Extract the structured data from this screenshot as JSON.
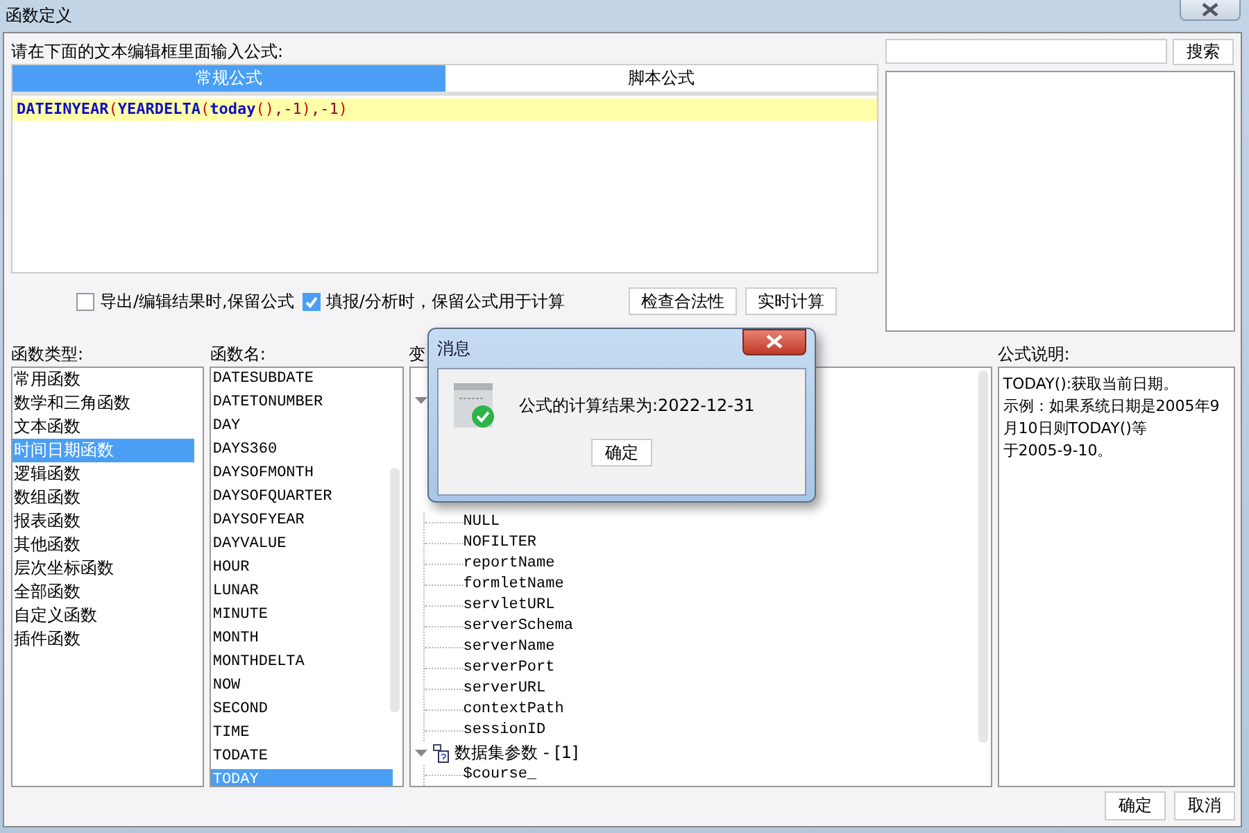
{
  "window": {
    "title": "函数定义"
  },
  "prompt": "请在下面的文本编辑框里面输入公式:",
  "tabs": [
    {
      "label": "常规公式",
      "selected": true
    },
    {
      "label": "脚本公式",
      "selected": false
    }
  ],
  "formula": [
    {
      "text": "DATEINYEAR",
      "kind": "function"
    },
    {
      "text": "(",
      "kind": "paren"
    },
    {
      "text": "YEARDELTA",
      "kind": "function"
    },
    {
      "text": "(",
      "kind": "paren"
    },
    {
      "text": "today",
      "kind": "function"
    },
    {
      "text": "()",
      "kind": "paren"
    },
    {
      "text": ",-1",
      "kind": "number"
    },
    {
      "text": ")",
      "kind": "paren"
    },
    {
      "text": ",-1",
      "kind": "number"
    },
    {
      "text": ")",
      "kind": "paren"
    }
  ],
  "search": {
    "button": "搜索"
  },
  "options": [
    {
      "label": "导出/编辑结果时,保留公式",
      "checked": false
    },
    {
      "label": "填报/分析时，保留公式用于计算",
      "checked": true
    }
  ],
  "actions": [
    "检查合法性",
    "实时计算"
  ],
  "categories": {
    "title": "函数类型:",
    "items": [
      {
        "label": "常用函数",
        "selected": false
      },
      {
        "label": "数学和三角函数",
        "selected": false
      },
      {
        "label": "文本函数",
        "selected": false
      },
      {
        "label": "时间日期函数",
        "selected": true
      },
      {
        "label": "逻辑函数",
        "selected": false
      },
      {
        "label": "数组函数",
        "selected": false
      },
      {
        "label": "报表函数",
        "selected": false
      },
      {
        "label": "其他函数",
        "selected": false
      },
      {
        "label": "层次坐标函数",
        "selected": false
      },
      {
        "label": "全部函数",
        "selected": false
      },
      {
        "label": "自定义函数",
        "selected": false
      },
      {
        "label": "插件函数",
        "selected": false
      }
    ]
  },
  "functions": {
    "title": "函数名:",
    "items": [
      {
        "label": "DATESUBDATE",
        "selected": false
      },
      {
        "label": "DATETONUMBER",
        "selected": false
      },
      {
        "label": "DAY",
        "selected": false
      },
      {
        "label": "DAYS360",
        "selected": false
      },
      {
        "label": "DAYSOFMONTH",
        "selected": false
      },
      {
        "label": "DAYSOFQUARTER",
        "selected": false
      },
      {
        "label": "DAYSOFYEAR",
        "selected": false
      },
      {
        "label": "DAYVALUE",
        "selected": false
      },
      {
        "label": "HOUR",
        "selected": false
      },
      {
        "label": "LUNAR",
        "selected": false
      },
      {
        "label": "MINUTE",
        "selected": false
      },
      {
        "label": "MONTH",
        "selected": false
      },
      {
        "label": "MONTHDELTA",
        "selected": false
      },
      {
        "label": "NOW",
        "selected": false
      },
      {
        "label": "SECOND",
        "selected": false
      },
      {
        "label": "TIME",
        "selected": false
      },
      {
        "label": "TODATE",
        "selected": false
      },
      {
        "label": "TODAY",
        "selected": true
      }
    ]
  },
  "variables": {
    "title": "变",
    "tree": [
      {
        "expanded": true,
        "children": [
          {
            "label": "NULL"
          },
          {
            "label": "NOFILTER"
          },
          {
            "label": "reportName"
          },
          {
            "label": "formletName"
          },
          {
            "label": "servletURL"
          },
          {
            "label": "serverSchema"
          },
          {
            "label": "serverName"
          },
          {
            "label": "serverPort"
          },
          {
            "label": "serverURL"
          },
          {
            "label": "contextPath"
          },
          {
            "label": "sessionID"
          }
        ]
      },
      {
        "label": "数据集参数 - [1]",
        "expanded": true,
        "children": [
          {
            "label": "$course_"
          }
        ]
      }
    ]
  },
  "description": {
    "title": "公式说明:",
    "lines": [
      "TODAY():获取当前日期。",
      "示例：如果系统日期是2005年9",
      "月10日则TODAY()等",
      "于2005-9-10。"
    ]
  },
  "buttons": [
    "确定",
    "取消"
  ],
  "message": {
    "title": "消息",
    "text": "公式的计算结果为:2022-12-31",
    "button": "确定"
  }
}
